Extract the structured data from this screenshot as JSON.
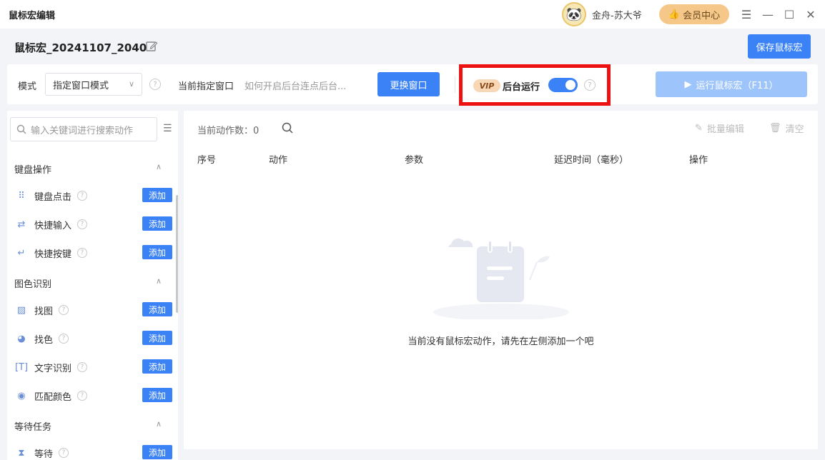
{
  "titlebar": {
    "app_title": "鼠标宏编辑",
    "user_name": "金舟-苏大爷",
    "vip_center": "会员中心"
  },
  "header": {
    "macro_name": "鼠标宏_20241107_2040",
    "save_label": "保存鼠标宏"
  },
  "toolbar": {
    "mode_label": "模式",
    "mode_value": "指定窗口模式",
    "current_window_label": "当前指定窗口",
    "current_window_hint": "如何开启后台连点后台...",
    "change_window_label": "更换窗口",
    "vip_tag": "VIP",
    "background_run_label": "后台运行",
    "background_run_on": true,
    "run_label": "运行鼠标宏（F11）"
  },
  "sidebar": {
    "search_placeholder": "输入关键词进行搜索动作",
    "add_label": "添加",
    "groups": [
      {
        "title": "键盘操作",
        "items": [
          "键盘点击",
          "快捷输入",
          "快捷按键"
        ]
      },
      {
        "title": "图色识别",
        "items": [
          "找图",
          "找色",
          "文字识别",
          "匹配颜色"
        ]
      },
      {
        "title": "等待任务",
        "items": [
          "等待"
        ]
      }
    ]
  },
  "main": {
    "count_label": "当前动作数：",
    "count_value": "0",
    "batch_edit_label": "批量编辑",
    "clear_label": "清空",
    "columns": [
      "序号",
      "动作",
      "参数",
      "延迟时间（毫秒）",
      "操作"
    ],
    "empty_text": "当前没有鼠标宏动作，请先在左侧添加一个吧"
  },
  "colors": {
    "primary": "#3b82f6",
    "highlight": "#ee1111",
    "vip_gold": "#f5c889"
  }
}
